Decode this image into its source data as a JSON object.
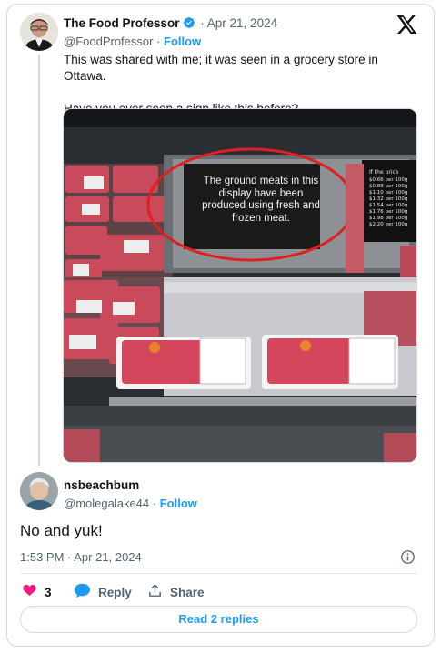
{
  "tweet": {
    "author_name": "The Food Professor",
    "date": "· Apr 21, 2024",
    "handle": "@FoodProfessor",
    "separator": " · ",
    "follow_label": "Follow",
    "text_line1": "This was shared with me; it was seen in a grocery store in Ottawa.",
    "text_line2": "Have you ever seen a sign like this before?",
    "image": {
      "sign_text": "The ground meats in this display have been produced using fresh and frozen meat.",
      "price_sign_title": "If the price",
      "price_lines": [
        "$0.66 per 100g",
        "$0.88 per 100g",
        "$1.10 per 100g",
        "$1.32 per 100g",
        "$1.54 per 100g",
        "$1.76 per 100g",
        "$1.98 per 100g",
        "$2.20 per 100g"
      ],
      "circle_color": "#e0201f"
    }
  },
  "reply": {
    "author_name": "nsbeachbum",
    "handle": "@molegalake44",
    "separator": " · ",
    "follow_label": "Follow",
    "text": "No and yuk!",
    "timestamp": "1:53 PM · Apr 21, 2024"
  },
  "actions": {
    "like_count": "3",
    "reply_label": "Reply",
    "share_label": "Share",
    "read_replies_label": "Read 2 replies"
  },
  "colors": {
    "accent": "#1d9bf0",
    "like": "#f91880",
    "secondary_text": "#536471"
  },
  "icons": [
    "verified-badge-icon",
    "x-logo-icon",
    "info-icon",
    "heart-icon",
    "reply-bubble-icon",
    "share-icon"
  ]
}
